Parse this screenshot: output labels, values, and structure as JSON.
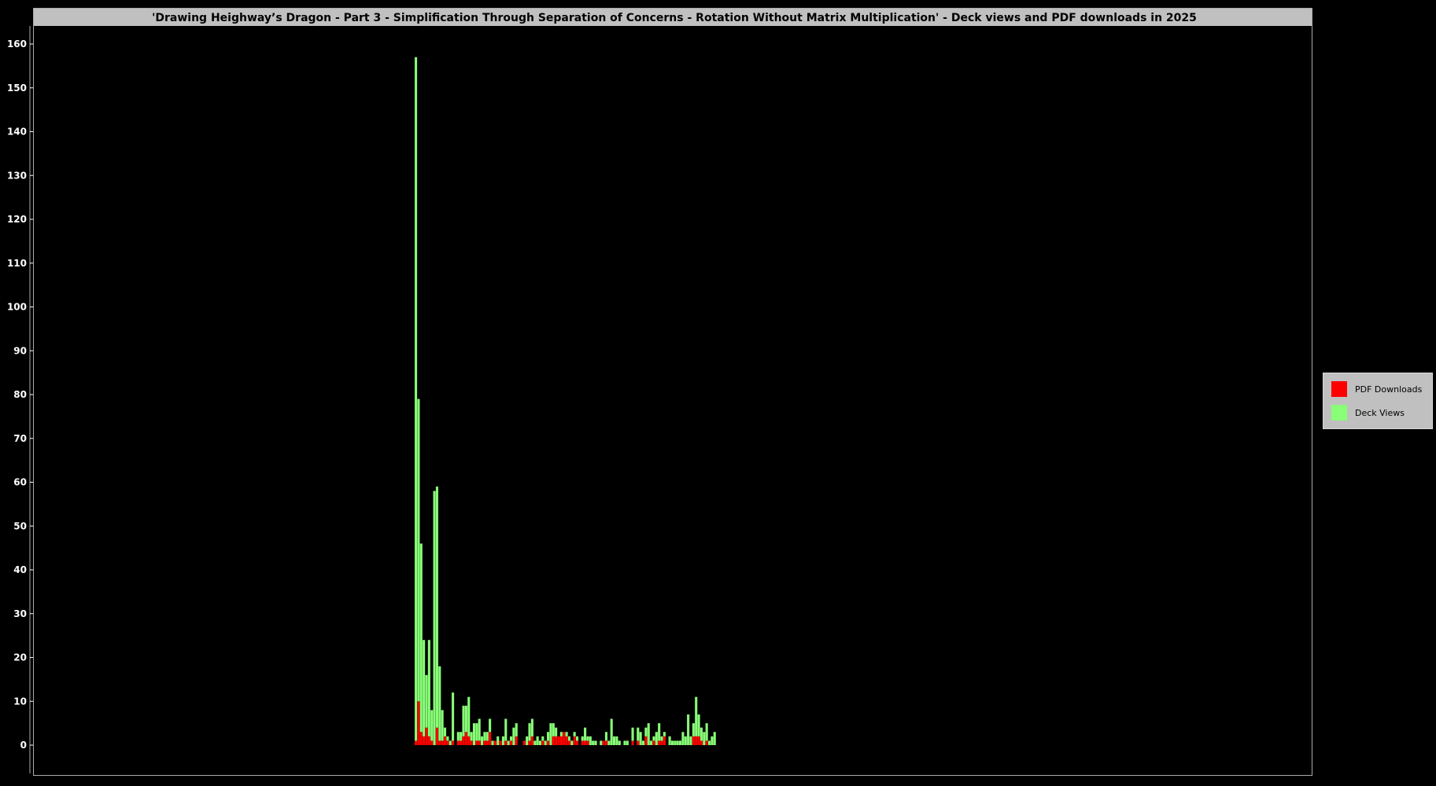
{
  "chart_data": {
    "type": "bar",
    "stacked": true,
    "title": "'Drawing Heighway’s Dragon - Part 3 - Simplification Through Separation of Concerns - Rotation Without Matrix Multiplication' - Deck views and PDF downloads in 2025",
    "xlabel": "",
    "ylabel": "",
    "ylim": [
      0,
      165
    ],
    "yticks": [
      0,
      10,
      20,
      30,
      40,
      50,
      60,
      70,
      80,
      90,
      100,
      110,
      120,
      130,
      140,
      150,
      160
    ],
    "grid": false,
    "legend_position": "right",
    "background": "#000000",
    "title_bar_color": "#c0c0c0",
    "series": [
      {
        "name": "PDF Downloads",
        "color": "#ff0000",
        "values": [
          1,
          10,
          3,
          2,
          4,
          2,
          1,
          0,
          4,
          1,
          1,
          2,
          1,
          0,
          1,
          0,
          1,
          1,
          2,
          3,
          2,
          1,
          0,
          1,
          1,
          0,
          1,
          1,
          3,
          0,
          1,
          0,
          1,
          0,
          1,
          0,
          1,
          0,
          2,
          0,
          0,
          1,
          0,
          1,
          2,
          0,
          0,
          0,
          1,
          0,
          1,
          0,
          2,
          2,
          2,
          2,
          3,
          2,
          1,
          0,
          2,
          1,
          0,
          1,
          1,
          1,
          0,
          0,
          0,
          0,
          0,
          1,
          1,
          0,
          0,
          0,
          0,
          0,
          0,
          0,
          0,
          0,
          1,
          0,
          1,
          0,
          0,
          2,
          0,
          0,
          1,
          0,
          1,
          1,
          2,
          0,
          0,
          0,
          0,
          0,
          0,
          0,
          0,
          0,
          0,
          2,
          2,
          2,
          1,
          0,
          1,
          0,
          0,
          0
        ]
      },
      {
        "name": "Deck Views",
        "color": "#88ff77",
        "values": [
          156,
          69,
          43,
          22,
          12,
          22,
          7,
          58,
          55,
          17,
          7,
          2,
          1,
          1,
          11,
          0,
          2,
          2,
          7,
          6,
          9,
          2,
          5,
          4,
          5,
          2,
          2,
          2,
          3,
          1,
          0,
          2,
          0,
          2,
          5,
          1,
          1,
          4,
          3,
          0,
          0,
          0,
          2,
          4,
          4,
          1,
          2,
          1,
          1,
          1,
          2,
          5,
          3,
          2,
          0,
          1,
          0,
          1,
          1,
          1,
          1,
          1,
          0,
          1,
          3,
          1,
          2,
          1,
          1,
          0,
          1,
          0,
          2,
          1,
          6,
          2,
          2,
          1,
          0,
          1,
          1,
          0,
          3,
          0,
          3,
          3,
          1,
          2,
          5,
          1,
          1,
          3,
          4,
          1,
          1,
          0,
          2,
          1,
          1,
          1,
          1,
          3,
          2,
          7,
          2,
          3,
          9,
          5,
          3,
          3,
          4,
          1,
          2,
          3
        ]
      }
    ]
  },
  "legend": [
    {
      "label": "PDF Downloads",
      "color": "#ff0000"
    },
    {
      "label": "Deck Views",
      "color": "#88ff77"
    }
  ]
}
